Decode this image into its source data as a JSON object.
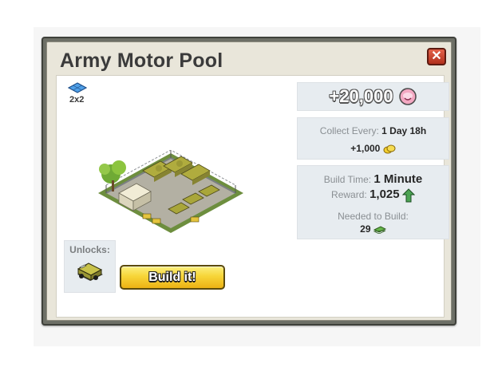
{
  "dialog": {
    "title": "Army Motor Pool",
    "close_icon": "close-x-icon",
    "size_label": "2x2",
    "size_icon": "blue-tile-icon"
  },
  "price": {
    "amount": "+20,000",
    "currency_icon": "pink-reward-icon"
  },
  "collect": {
    "label": "Collect Every:",
    "interval": "1 Day 18h",
    "yield": "+1,000",
    "yield_icon": "gold-coins-icon"
  },
  "build": {
    "time_label": "Build Time:",
    "time_value": "1 Minute",
    "reward_label": "Reward:",
    "reward_value": "1,025",
    "reward_icon": "xp-icon",
    "needed_label": "Needed to Build:",
    "needed_value": "29",
    "needed_icon": "green-cash-icon"
  },
  "unlocks": {
    "label": "Unlocks:",
    "item_icon": "army-truck-icon"
  },
  "build_button": {
    "label": "Build it!"
  },
  "colors": {
    "frame": "#6d6f66",
    "panel": "#e7ecf0",
    "button_yellow": "#f7d538",
    "close_red": "#c64a33"
  }
}
